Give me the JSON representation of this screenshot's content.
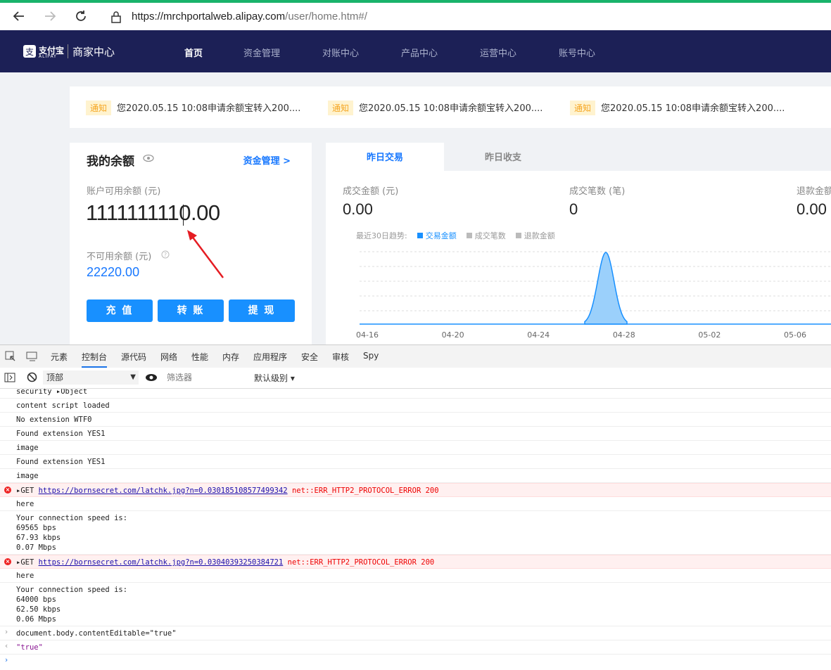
{
  "browser": {
    "url_host": "https://mrchportalweb.alipay.com",
    "url_path": "/user/home.htm#/"
  },
  "header": {
    "logo_brand": "支付宝",
    "logo_sub": "ALIPAY",
    "logo_text": "商家中心",
    "nav": [
      "首页",
      "资金管理",
      "对账中心",
      "产品中心",
      "运营中心",
      "账号中心"
    ]
  },
  "notices": [
    {
      "tag": "通知",
      "text": "您2020.05.15 10:08申请余额宝转入200...."
    },
    {
      "tag": "通知",
      "text": "您2020.05.15 10:08申请余额宝转入200...."
    },
    {
      "tag": "通知",
      "text": "您2020.05.15 10:08申请余额宝转入200...."
    }
  ],
  "balance": {
    "title": "我的余额",
    "fund_link": "资金管理 >",
    "available_label": "账户可用余额 (元)",
    "available_value": "1111111110.00",
    "unavailable_label": "不可用余额 (元)",
    "unavailable_value": "22220.00",
    "buttons": [
      "充 值",
      "转 账",
      "提 现"
    ]
  },
  "trade": {
    "tabs": [
      "昨日交易",
      "昨日收支"
    ],
    "stats": [
      {
        "label": "成交金额 (元)",
        "value": "0.00"
      },
      {
        "label": "成交笔数 (笔)",
        "value": "0"
      },
      {
        "label": "退款金额",
        "value": "0.00"
      }
    ],
    "trend_label": "最近30日趋势:",
    "legend": [
      "交易金额",
      "成交笔数",
      "退款金额"
    ]
  },
  "chart_data": {
    "type": "area",
    "x_ticks": [
      "04-16",
      "04-20",
      "04-24",
      "04-28",
      "05-02",
      "05-06"
    ],
    "series": [
      {
        "name": "交易金额",
        "color": "#1890ff",
        "peak_date": "04-27",
        "note_values": "zero except single peak around 04-27"
      }
    ]
  },
  "devtools": {
    "tabs": [
      "元素",
      "控制台",
      "源代码",
      "网络",
      "性能",
      "内存",
      "应用程序",
      "安全",
      "审核",
      "Spy"
    ],
    "context": "顶部",
    "filter_placeholder": "筛选器",
    "level": "默认级别 ▾",
    "logs": [
      {
        "type": "log",
        "lines": [
          "security ▸Object"
        ]
      },
      {
        "type": "log",
        "lines": [
          "content script loaded"
        ]
      },
      {
        "type": "log",
        "lines": [
          "No extension WTF0"
        ]
      },
      {
        "type": "log",
        "lines": [
          "Found extension YES1"
        ]
      },
      {
        "type": "log",
        "lines": [
          "image"
        ]
      },
      {
        "type": "log",
        "lines": [
          "Found extension YES1"
        ]
      },
      {
        "type": "log",
        "lines": [
          "image"
        ]
      },
      {
        "type": "error",
        "prefix": "▸GET ",
        "link": "https://bornsecret.com/latchk.jpg?n=0.030185108577499342",
        "suffix": " net::ERR_HTTP2_PROTOCOL_ERROR 200"
      },
      {
        "type": "log",
        "lines": [
          "here"
        ]
      },
      {
        "type": "log",
        "lines": [
          "Your connection speed is:",
          "69565 bps",
          "67.93 kbps",
          "0.07 Mbps"
        ]
      },
      {
        "type": "error",
        "prefix": "▸GET ",
        "link": "https://bornsecret.com/latchk.jpg?n=0.03040393250384721",
        "suffix": " net::ERR_HTTP2_PROTOCOL_ERROR 200"
      },
      {
        "type": "log",
        "lines": [
          "here"
        ]
      },
      {
        "type": "log",
        "lines": [
          "Your connection speed is:",
          "64000 bps",
          "62.50 kbps",
          "0.06 Mbps"
        ]
      },
      {
        "type": "input",
        "lines": [
          "document.body.contentEditable=\"true\""
        ]
      },
      {
        "type": "result",
        "lines": [
          "\"true\""
        ]
      }
    ]
  }
}
